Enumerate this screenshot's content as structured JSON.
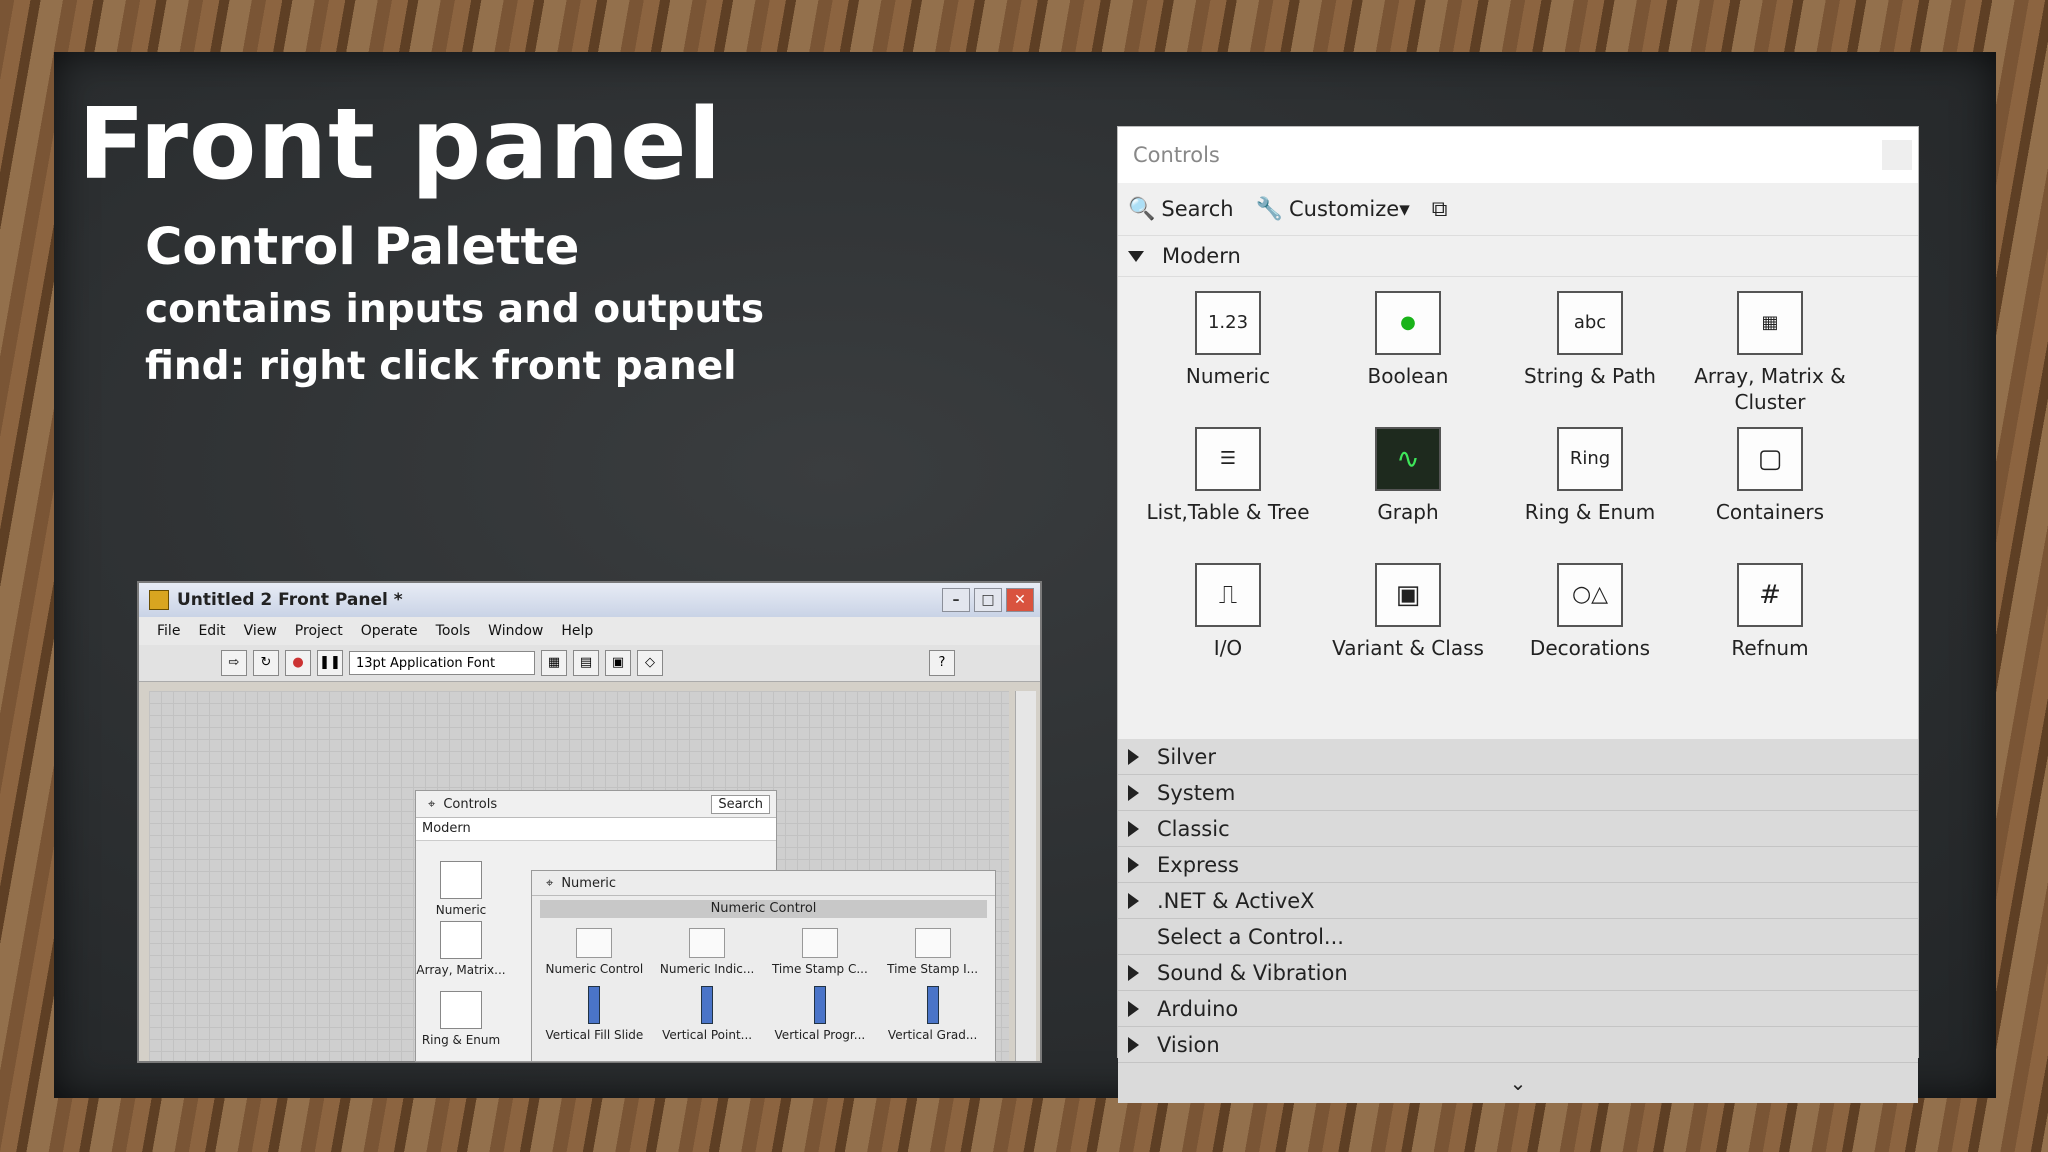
{
  "slide": {
    "title": "Front panel",
    "subtitle": "Control Palette",
    "line1": "contains inputs and outputs",
    "line2": "find: right click front panel"
  },
  "front_panel_window": {
    "title": "Untitled 2 Front Panel *",
    "menu": [
      "File",
      "Edit",
      "View",
      "Project",
      "Operate",
      "Tools",
      "Window",
      "Help"
    ],
    "font_select": "13pt Application Font",
    "mini_palette": {
      "title": "Controls",
      "search": "Search",
      "modern": "Modern",
      "items": [
        "Numeric",
        "Array, Matrix...",
        "Ring & Enum"
      ]
    },
    "numeric_subpalette": {
      "title": "Numeric",
      "band": "Numeric Control",
      "row1": [
        "Numeric Control",
        "Numeric Indic...",
        "Time Stamp C...",
        "Time Stamp I..."
      ],
      "row2": [
        "Vertical Fill Slide",
        "Vertical Point...",
        "Vertical Progr...",
        "Vertical Grad..."
      ]
    }
  },
  "controls_palette": {
    "title": "Controls",
    "search_label": "Search",
    "customize_label": "Customize▾",
    "modern_label": "Modern",
    "items": [
      {
        "label": "Numeric",
        "glyph": "1.23"
      },
      {
        "label": "Boolean",
        "glyph": "●"
      },
      {
        "label": "String & Path",
        "glyph": "abc"
      },
      {
        "label": "Array, Matrix & Cluster",
        "glyph": "▦"
      },
      {
        "label": "List,Table & Tree",
        "glyph": "☰"
      },
      {
        "label": "Graph",
        "glyph": "∿"
      },
      {
        "label": "Ring & Enum",
        "glyph": "Ring"
      },
      {
        "label": "Containers",
        "glyph": "▢"
      },
      {
        "label": "I/O",
        "glyph": "⎍"
      },
      {
        "label": "Variant & Class",
        "glyph": "▣"
      },
      {
        "label": "Decorations",
        "glyph": "○△"
      },
      {
        "label": "Refnum",
        "glyph": "#"
      }
    ],
    "categories": [
      {
        "label": "Silver",
        "arrow": true
      },
      {
        "label": "System",
        "arrow": true
      },
      {
        "label": "Classic",
        "arrow": true
      },
      {
        "label": "Express",
        "arrow": true
      },
      {
        "label": ".NET & ActiveX",
        "arrow": true
      },
      {
        "label": "Select a Control...",
        "arrow": false
      },
      {
        "label": "Sound & Vibration",
        "arrow": true
      },
      {
        "label": "Arduino",
        "arrow": true
      },
      {
        "label": "Vision",
        "arrow": true
      }
    ],
    "more_glyph": "⌄"
  },
  "colors": {
    "board": "#2c2f31",
    "frame": "#7a5535",
    "palette_bg": "#f0f0f0",
    "category_bg": "#dadada"
  }
}
